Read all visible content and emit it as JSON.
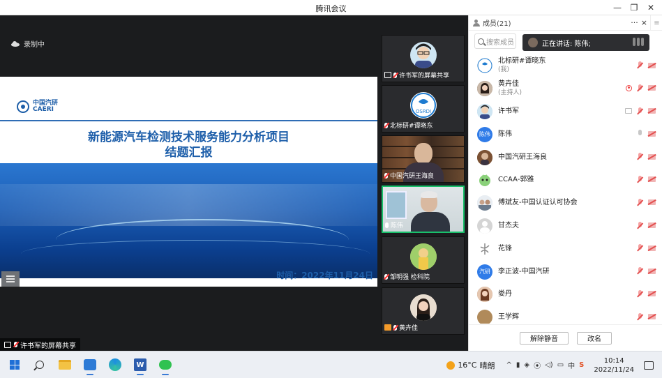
{
  "window": {
    "title": "腾讯会议",
    "controls": [
      "minimize",
      "restore",
      "close"
    ]
  },
  "share": {
    "recording_label": "录制中",
    "slide": {
      "org_cn": "中国汽研",
      "org_en": "CAERI",
      "title_line1": "新能源汽车检测技术服务能力分析项目",
      "title_line2": "结题汇报",
      "date": "时间：2022年11月24日"
    },
    "sharer_label": "许书军的屏幕共享"
  },
  "video_tiles": [
    {
      "label": "许书军的屏幕共享",
      "type": "avatar",
      "avatar_color": "#cfe6f3",
      "mic": "muted",
      "screen": true
    },
    {
      "label": "北标研#谭晓东",
      "type": "avatar",
      "avatar_color": "#ffffff",
      "mic": "muted",
      "screen": false
    },
    {
      "label": "中国汽研王海良",
      "type": "video-room",
      "mic": "muted",
      "screen": false
    },
    {
      "label": "陈伟",
      "type": "video-office",
      "mic": "on",
      "screen": false,
      "active": true
    },
    {
      "label": "邹明强 检科院",
      "type": "avatar",
      "avatar_color": "#f0d36a",
      "mic": "muted",
      "screen": false
    },
    {
      "label": "黄卉佳",
      "type": "avatar",
      "avatar_color": "#c9b8a8",
      "mic": "muted",
      "screen": false,
      "host_badge": true
    }
  ],
  "members": {
    "title": "成员(21)",
    "header_actions": [
      "···",
      "×"
    ],
    "search_placeholder": "搜索成员",
    "speaking_label": "正在讲话: 陈伟;",
    "list": [
      {
        "name": "北标研#谭晓东",
        "sub": "(我)",
        "avatar": "#e8eef5",
        "avatar_text": "",
        "mic": "muted",
        "cam": "off"
      },
      {
        "name": "黄卉佳",
        "sub": "(主持人)",
        "avatar": "#6b5a4c",
        "avatar_text": "",
        "mic": "muted",
        "cam": "off",
        "rec": true
      },
      {
        "name": "许书军",
        "sub": "",
        "avatar": "#9bc6e0",
        "avatar_text": "",
        "mic": "muted",
        "cam": "off",
        "share": true
      },
      {
        "name": "陈伟",
        "sub": "",
        "avatar": "#2f7be8",
        "avatar_text": "陈伟",
        "mic": "on",
        "cam": "off"
      },
      {
        "name": "中国汽研王海良",
        "sub": "",
        "avatar": "#8a6a4c",
        "avatar_text": "",
        "mic": "muted",
        "cam": "off"
      },
      {
        "name": "CCAA-郭雅",
        "sub": "",
        "avatar": "#8ad17a",
        "avatar_text": "",
        "mic": "muted",
        "cam": "off"
      },
      {
        "name": "傅斌友-中国认证认可协会",
        "sub": "",
        "avatar": "#c8d3de",
        "avatar_text": "",
        "mic": "muted",
        "cam": "off"
      },
      {
        "name": "甘杰夫",
        "sub": "",
        "avatar": "#d5d5d5",
        "avatar_text": "",
        "mic": "muted",
        "cam": "off"
      },
      {
        "name": "花锋",
        "sub": "",
        "avatar": "#e5e5ea",
        "avatar_text": "",
        "mic": "muted",
        "cam": "off"
      },
      {
        "name": "李正波-中国汽研",
        "sub": "",
        "avatar": "#2f7be8",
        "avatar_text": "汽研",
        "mic": "muted",
        "cam": "off"
      },
      {
        "name": "娄丹",
        "sub": "",
        "avatar": "#a07a62",
        "avatar_text": "",
        "mic": "muted",
        "cam": "off"
      },
      {
        "name": "王学辉",
        "sub": "",
        "avatar": "#b08a5a",
        "avatar_text": "",
        "mic": "muted",
        "cam": "off"
      }
    ],
    "footer": {
      "unmute_all": "解除静音",
      "rename": "改名"
    }
  },
  "taskbar": {
    "apps": [
      "windows-start",
      "search",
      "file-explorer",
      "tencent-meeting",
      "edge",
      "word",
      "wechat"
    ],
    "weather": {
      "temp": "16°C",
      "desc": "晴朗"
    },
    "tray": [
      "^",
      "中",
      "S"
    ],
    "time": "10:14",
    "date": "2022/11/24"
  }
}
